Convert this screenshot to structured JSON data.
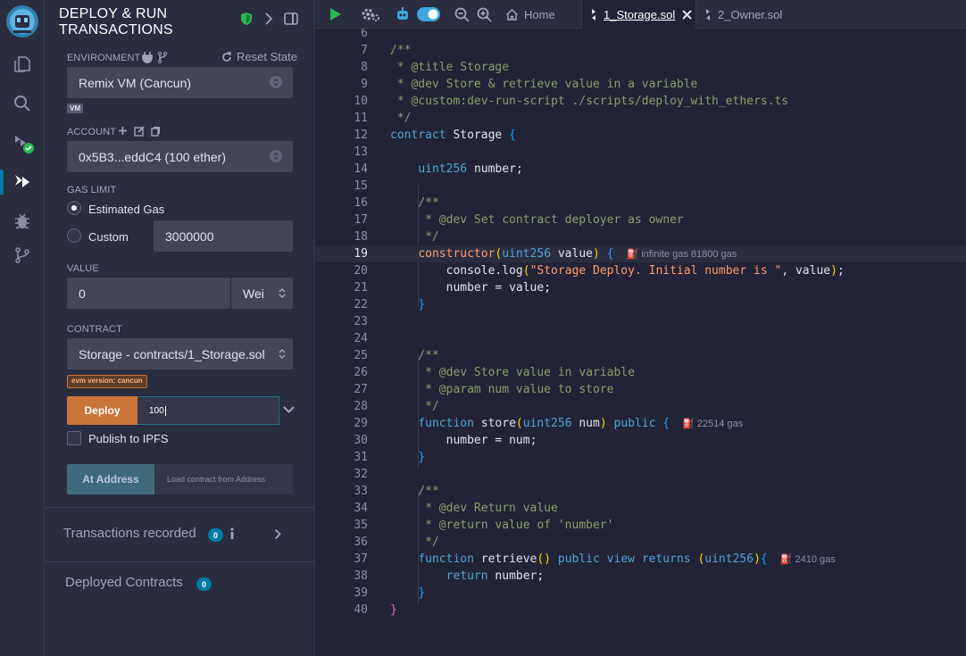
{
  "panel": {
    "title": "DEPLOY & RUN\nTRANSACTIONS",
    "environment_label": "ENVIRONMENT",
    "reset_state": "Reset State",
    "environment_value": "Remix VM (Cancun)",
    "vm_badge": "VM",
    "account_label": "ACCOUNT",
    "account_value": "0x5B3...eddC4 (100 ether)",
    "gas_limit_label": "GAS LIMIT",
    "estimated_gas": "Estimated Gas",
    "custom": "Custom",
    "custom_gas_value": "3000000",
    "value_label": "VALUE",
    "value_amount": "0",
    "value_unit": "Wei",
    "contract_label": "CONTRACT",
    "contract_value": "Storage - contracts/1_Storage.sol",
    "evm_badge": "evm version: cancun",
    "deploy_label": "Deploy",
    "deploy_arg": "100",
    "publish_ipfs": "Publish to IPFS",
    "at_address": "At Address",
    "load_contract_placeholder": "Load contract from Address",
    "transactions_recorded": "Transactions recorded",
    "transactions_count": "0",
    "deployed_contracts": "Deployed Contracts",
    "deployed_count": "0"
  },
  "tabs": {
    "home": "Home",
    "storage": "1_Storage.sol",
    "owner": "2_Owner.sol"
  },
  "editor": {
    "current_line": 19,
    "lines": [
      {
        "n": "6",
        "code": ""
      },
      {
        "n": "7",
        "code": "/**"
      },
      {
        "n": "8",
        "code": " * @title Storage"
      },
      {
        "n": "9",
        "code": " * @dev Store & retrieve value in a variable"
      },
      {
        "n": "10",
        "code": " * @custom:dev-run-script ./scripts/deploy_with_ethers.ts"
      },
      {
        "n": "11",
        "code": " */"
      },
      {
        "n": "12",
        "code": "contract Storage {"
      },
      {
        "n": "13",
        "code": ""
      },
      {
        "n": "14",
        "code": "    uint256 number;"
      },
      {
        "n": "15",
        "code": ""
      },
      {
        "n": "16",
        "code": "    /**"
      },
      {
        "n": "17",
        "code": "     * @dev Set contract deployer as owner"
      },
      {
        "n": "18",
        "code": "     */"
      },
      {
        "n": "19",
        "code": "    constructor(uint256 value) {",
        "gas": "infinite gas 81800 gas"
      },
      {
        "n": "20",
        "code": "        console.log(\"Storage Deploy. Initial number is \", value);"
      },
      {
        "n": "21",
        "code": "        number = value;"
      },
      {
        "n": "22",
        "code": "    }"
      },
      {
        "n": "23",
        "code": ""
      },
      {
        "n": "24",
        "code": ""
      },
      {
        "n": "25",
        "code": "    /**"
      },
      {
        "n": "26",
        "code": "     * @dev Store value in variable"
      },
      {
        "n": "27",
        "code": "     * @param num value to store"
      },
      {
        "n": "28",
        "code": "     */"
      },
      {
        "n": "29",
        "code": "    function store(uint256 num) public {",
        "gas": "22514 gas"
      },
      {
        "n": "30",
        "code": "        number = num;"
      },
      {
        "n": "31",
        "code": "    }"
      },
      {
        "n": "32",
        "code": ""
      },
      {
        "n": "33",
        "code": "    /**"
      },
      {
        "n": "34",
        "code": "     * @dev Return value"
      },
      {
        "n": "35",
        "code": "     * @return value of 'number'"
      },
      {
        "n": "36",
        "code": "     */"
      },
      {
        "n": "37",
        "code": "    function retrieve() public view returns (uint256){",
        "gas": "2410 gas"
      },
      {
        "n": "38",
        "code": "        return number;"
      },
      {
        "n": "39",
        "code": "    }"
      },
      {
        "n": "40",
        "code": "}"
      }
    ]
  }
}
